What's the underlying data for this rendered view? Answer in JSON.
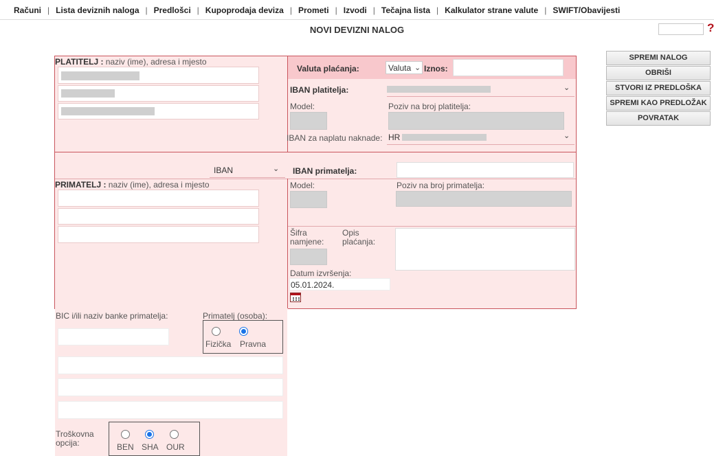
{
  "nav": {
    "items": [
      "Računi",
      "Lista deviznih naloga",
      "Predlošci",
      "Kupoprodaja deviza",
      "Prometi",
      "Izvodi",
      "Tečajna lista",
      "Kalkulator strane valute",
      "SWIFT/Obavijesti"
    ]
  },
  "page": {
    "title": "NOVI DEVIZNI NALOG"
  },
  "help": {
    "glyph": "?"
  },
  "platitelj": {
    "label_bold": "PLATITELJ :",
    "label_rest": " naziv (ime), adresa i mjesto"
  },
  "payment": {
    "currency_label": "Valuta plaćanja:",
    "currency_value": "Valuta",
    "amount_label": "Iznos:",
    "iban_payer_label": "IBAN platitelja:",
    "model_label": "Model:",
    "reference_payer_label": "Poziv na broj platitelja:",
    "iban_fee_label": "IBAN za naplatu naknade:",
    "iban_fee_prefix": "HR"
  },
  "primatelj": {
    "account_type_value": "IBAN",
    "iban_label": "IBAN primatelja:",
    "label_bold": "PRIMATELJ :",
    "label_rest": " naziv (ime), adresa i mjesto",
    "model_label": "Model:",
    "reference_label": "Poziv na broj primatelja:",
    "purpose_code_label": "Šifra namjene:",
    "description_label": "Opis plaćanja:",
    "exec_date_label": "Datum izvršenja:",
    "exec_date_value": "05.01.2024."
  },
  "bank": {
    "bic_label": "BIC i/ili naziv banke primatelja:",
    "recipient_type_label": "Primatelj (osoba):",
    "type_options": [
      "Fizička",
      "Pravna"
    ],
    "type_selected": "Pravna",
    "cost_label": "Troškovna opcija:",
    "cost_options": [
      "BEN",
      "SHA",
      "OUR"
    ],
    "cost_selected": "SHA"
  },
  "actions": {
    "save": "SPREMI NALOG",
    "delete": "OBRIŠI",
    "create_from_template": "STVORI IZ PREDLOŠKA",
    "save_as_template": "SPREMI KAO PREDLOŽAK",
    "back": "POVRATAK"
  },
  "colors": {
    "pink_bg": "#fde8e8",
    "header_pink": "#f8c8cc",
    "border_red": "#c9545c",
    "radio_blue": "#1a73e8",
    "help_red": "#b3121b"
  }
}
